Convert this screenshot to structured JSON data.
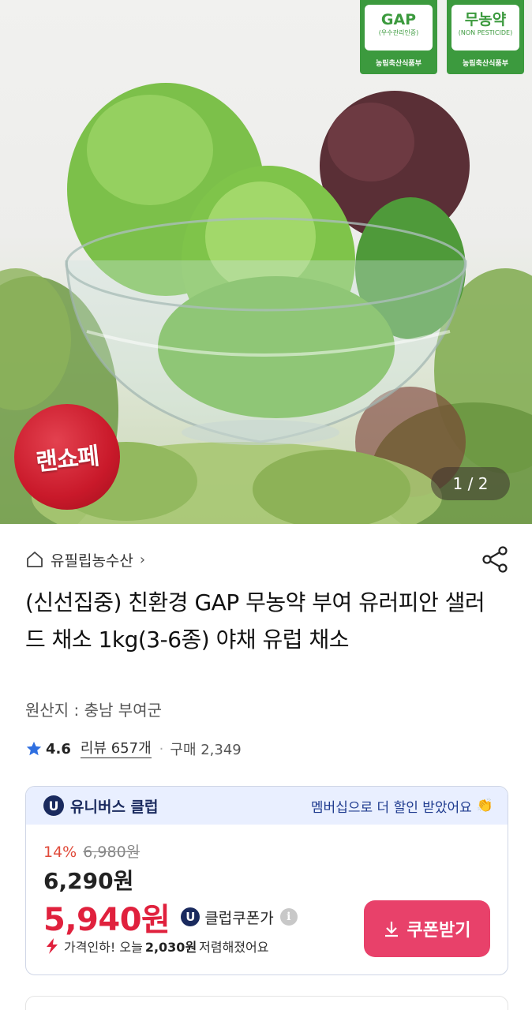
{
  "hero": {
    "cert_gap": {
      "big": "GAP",
      "small": "(우수관리인증)",
      "issuer": "농림축산식품부"
    },
    "cert_nopesticide": {
      "big": "무농약",
      "small": "(NON PESTICIDE)",
      "issuer": "농림축산식품부"
    },
    "promo_badge": "랜쇼페",
    "page_indicator": "1 / 2"
  },
  "seller": {
    "name": "유필립농수산",
    "chevron": "›"
  },
  "product": {
    "title": "(신선집중) 친환경 GAP 무농약 부여 유러피안 샐러드 채소 1kg(3-6종) 야채 유럽 채소",
    "origin": "원산지 : 충남 부여군"
  },
  "rating": {
    "score": "4.6",
    "reviews": "리뷰 657개",
    "separator": "·",
    "purchases": "구매 2,349"
  },
  "club": {
    "icon_letter": "U",
    "name": "유니버스 클럽",
    "note": "멤버십으로 더 할인 받았어요",
    "discount_rate": "14%",
    "original_price": "6,980원",
    "sale_price": "6,290원",
    "coupon_price": "5,940원",
    "coupon_label": "클럽쿠폰가",
    "info_symbol": "i",
    "drop_prefix": "가격인하! 오늘",
    "drop_amount": "2,030원",
    "drop_suffix": "저렴해졌어요",
    "button_label": "쿠폰받기"
  },
  "colors": {
    "accent_pink": "#e8416a",
    "price_red": "#e0213d",
    "club_navy": "#1a2a5e",
    "cert_green": "#3c9a3e",
    "star_blue": "#2f6fe0"
  },
  "icons": [
    "home-icon",
    "share-icon",
    "star-icon",
    "u-club-icon",
    "clap-icon",
    "info-icon",
    "bolt-icon",
    "download-icon"
  ]
}
